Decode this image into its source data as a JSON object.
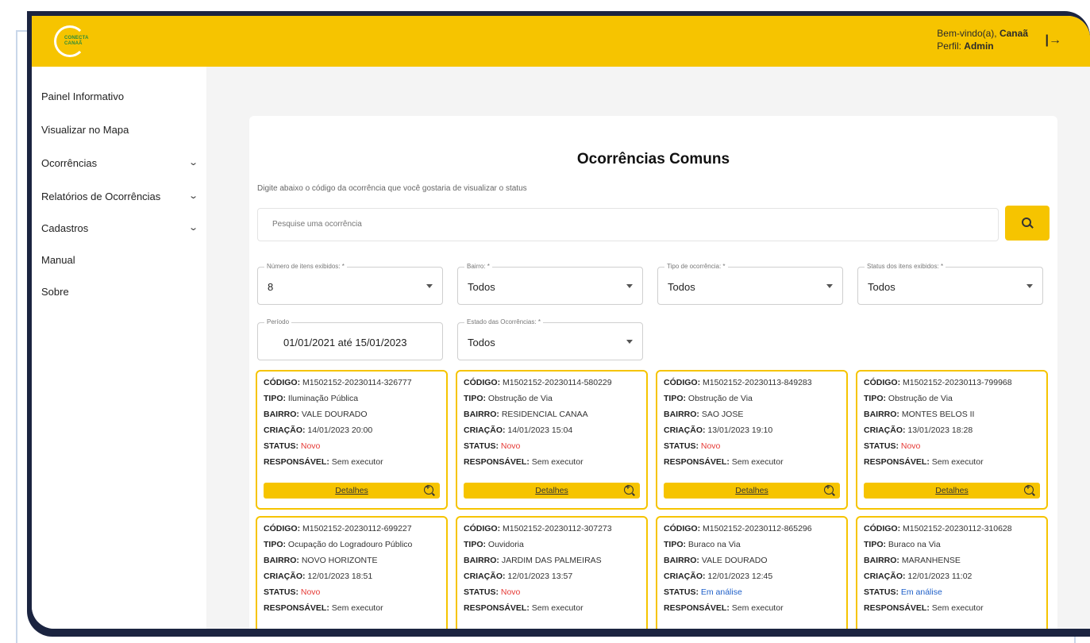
{
  "app": {
    "logo_text_1": "CONECTA",
    "logo_text_2": "CANAÃ"
  },
  "header": {
    "welcome_prefix": "Bem-vindo(a), ",
    "welcome_name": "Canaã",
    "profile_prefix": "Perfil: ",
    "profile_name": "Admin",
    "logout_icon": "logout-icon"
  },
  "sidebar": {
    "items": [
      {
        "label": "Painel Informativo",
        "has_chevron": false
      },
      {
        "label": "Visualizar no Mapa",
        "has_chevron": false
      },
      {
        "label": "Ocorrências",
        "has_chevron": true
      },
      {
        "label": "Relatórios de Ocorrências",
        "has_chevron": true
      },
      {
        "label": "Cadastros",
        "has_chevron": true
      },
      {
        "label": "Manual",
        "has_chevron": false
      },
      {
        "label": "Sobre",
        "has_chevron": false
      }
    ]
  },
  "main": {
    "title": "Ocorrências Comuns",
    "subtitle": "Digite abaixo o código da ocorrência que você gostaria de visualizar o status",
    "search_placeholder": "Pesquise uma ocorrência",
    "filters": {
      "num_items": {
        "label": "Número de itens exibidos: *",
        "value": "8"
      },
      "bairro": {
        "label": "Bairro: *",
        "value": "Todos"
      },
      "tipo": {
        "label": "Tipo de ocorrência: *",
        "value": "Todos"
      },
      "status": {
        "label": "Status dos itens exibidos: *",
        "value": "Todos"
      },
      "periodo": {
        "label": "Período",
        "value": "01/01/2021 até 15/01/2023"
      },
      "estado": {
        "label": "Estado das Ocorrências: *",
        "value": "Todos"
      }
    },
    "field_labels": {
      "codigo": "CÓDIGO:",
      "tipo": "TIPO:",
      "bairro": "BAIRRO:",
      "criacao": "CRIAÇÃO:",
      "status": "STATUS:",
      "responsavel": "RESPONSÁVEL:"
    },
    "details_label": "Detalhes",
    "occurrences": [
      {
        "codigo": "M1502152-20230114-326777",
        "tipo": "Iluminação Pública",
        "bairro": "VALE DOURADO",
        "criacao": "14/01/2023 20:00",
        "status": "Novo",
        "responsavel": "Sem executor"
      },
      {
        "codigo": "M1502152-20230114-580229",
        "tipo": "Obstrução de Via",
        "bairro": "RESIDENCIAL CANAA",
        "criacao": "14/01/2023 15:04",
        "status": "Novo",
        "responsavel": "Sem executor"
      },
      {
        "codigo": "M1502152-20230113-849283",
        "tipo": "Obstrução de Via",
        "bairro": "SAO JOSE",
        "criacao": "13/01/2023 19:10",
        "status": "Novo",
        "responsavel": "Sem executor"
      },
      {
        "codigo": "M1502152-20230113-799968",
        "tipo": "Obstrução de Via",
        "bairro": "MONTES BELOS II",
        "criacao": "13/01/2023 18:28",
        "status": "Novo",
        "responsavel": "Sem executor"
      },
      {
        "codigo": "M1502152-20230112-699227",
        "tipo": "Ocupação do Logradouro Público",
        "bairro": "NOVO HORIZONTE",
        "criacao": "12/01/2023 18:51",
        "status": "Novo",
        "responsavel": "Sem executor"
      },
      {
        "codigo": "M1502152-20230112-307273",
        "tipo": "Ouvidoria",
        "bairro": "JARDIM DAS PALMEIRAS",
        "criacao": "12/01/2023 13:57",
        "status": "Novo",
        "responsavel": "Sem executor"
      },
      {
        "codigo": "M1502152-20230112-865296",
        "tipo": "Buraco na Via",
        "bairro": "VALE DOURADO",
        "criacao": "12/01/2023 12:45",
        "status": "Em análise",
        "responsavel": "Sem executor"
      },
      {
        "codigo": "M1502152-20230112-310628",
        "tipo": "Buraco na Via",
        "bairro": "MARANHENSE",
        "criacao": "12/01/2023 11:02",
        "status": "Em análise",
        "responsavel": "Sem executor"
      }
    ]
  },
  "colors": {
    "brand_yellow": "#f6c400",
    "status_novo": "#e53935",
    "status_analise": "#1e5fc8",
    "frame": "#1b2440"
  }
}
